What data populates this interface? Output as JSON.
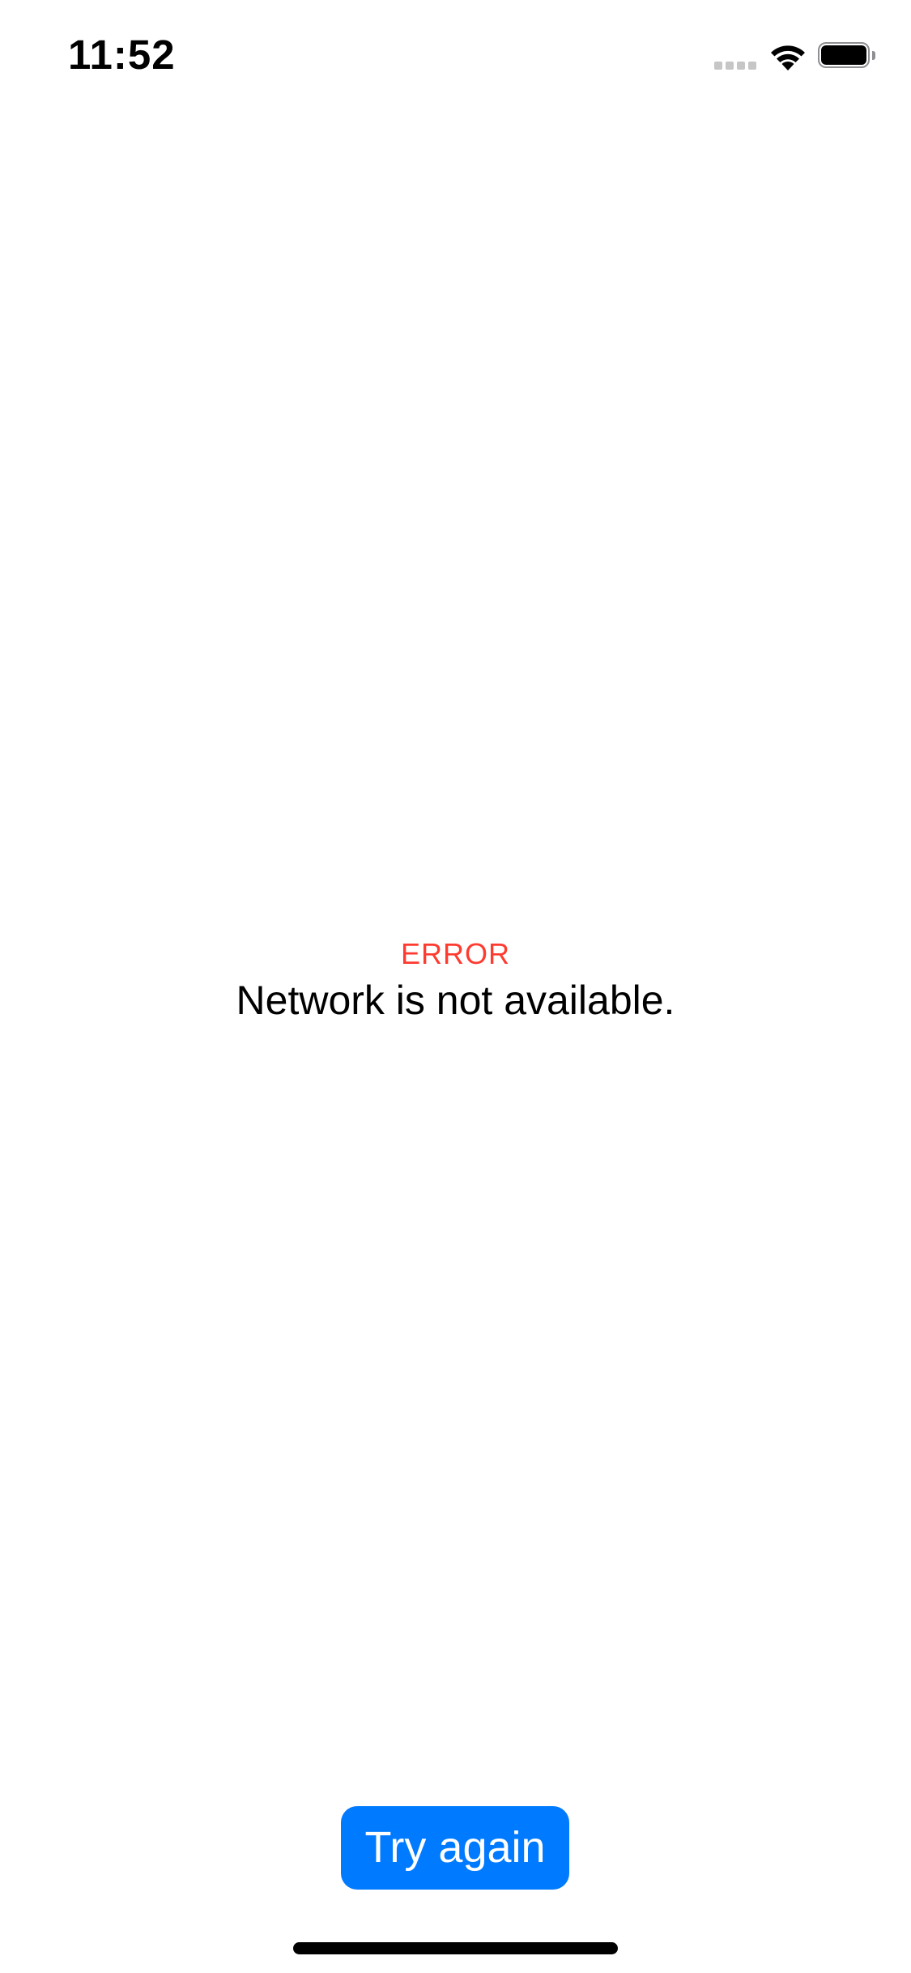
{
  "status_bar": {
    "time": "11:52",
    "signal_icon": "cellular-signal-icon",
    "wifi_icon": "wifi-icon",
    "battery_icon": "battery-icon",
    "battery_level": 1.0
  },
  "error": {
    "label": "ERROR",
    "message": "Network is not available.",
    "label_color": "#ff3b30"
  },
  "actions": {
    "try_again_label": "Try again",
    "button_color": "#007aff"
  }
}
